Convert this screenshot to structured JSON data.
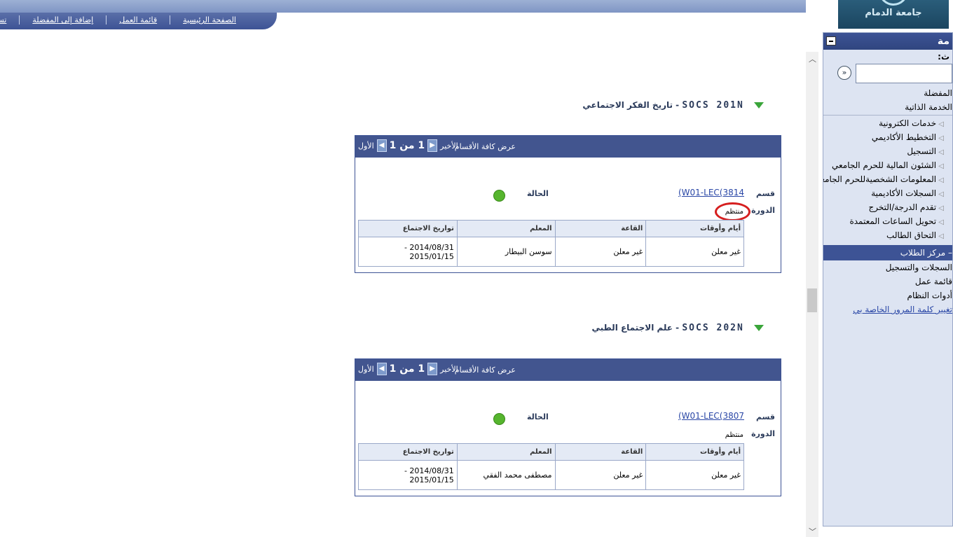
{
  "nav": {
    "home": "الصفحة الرئيسية",
    "worklist": "قائمة العمل",
    "add_favorites": "إضافة إلى المفضلة",
    "logout": "تسجيل الخروج"
  },
  "logo": {
    "text": "جامعة الدمام"
  },
  "menu": {
    "title": "مة",
    "search_label": "ث:",
    "favorites": "المفضلة",
    "self_service": "الخدمة الذاتية",
    "items": [
      "خدمات الكترونية",
      "التخطيط الأكاديمي",
      "التسجيل",
      "الشئون المالية للحرم الجامعي",
      "المعلومات الشخصيةللحرم الجامعي",
      "السجلات الأكاديمية",
      "تقدم الدرجة/التخرج",
      "تحويل الساعات المعتمدة",
      "التحاق الطالب"
    ],
    "section": "– مركز الطلاب",
    "items2": [
      "السجلات والتسجيل",
      "قائمة عمل",
      "أدوات النظام"
    ],
    "link": "تغيير كلمة المرور الخاصة بي"
  },
  "courses": [
    {
      "code": "SOCS 201N",
      "title": "- تاريخ الفكر الاجتماعي",
      "view_all": "عرض كافة الأقسام",
      "first": "الأول",
      "page": "1 من 1",
      "last": "الأخير",
      "section_label": "قسم",
      "section_link": "(W01-LEC(3814",
      "session_label": "الدورة",
      "session": "منتظم",
      "status_label": "الحالة",
      "headers": [
        "أيام وأوقات",
        "القاعة",
        "المعلم",
        "تواريخ الاجتماع"
      ],
      "row": [
        "غير معلن",
        "غير معلن",
        "سوسن البيطار",
        "2014/08/31 -\n2015/01/15"
      ]
    },
    {
      "code": "SOCS 202N",
      "title": "- علم الاجتماع الطبي",
      "view_all": "عرض كافة الأقسام",
      "first": "الأول",
      "page": "1 من 1",
      "last": "الأخير",
      "section_label": "قسم",
      "section_link": "(W01-LEC(3807",
      "session_label": "الدورة",
      "session": "منتظم",
      "status_label": "الحالة",
      "headers": [
        "أيام وأوقات",
        "القاعة",
        "المعلم",
        "تواريخ الاجتماع"
      ],
      "row": [
        "غير معلن",
        "غير معلن",
        "مصطفى محمد الفقي",
        "2014/08/31 -\n2015/01/15"
      ]
    }
  ]
}
